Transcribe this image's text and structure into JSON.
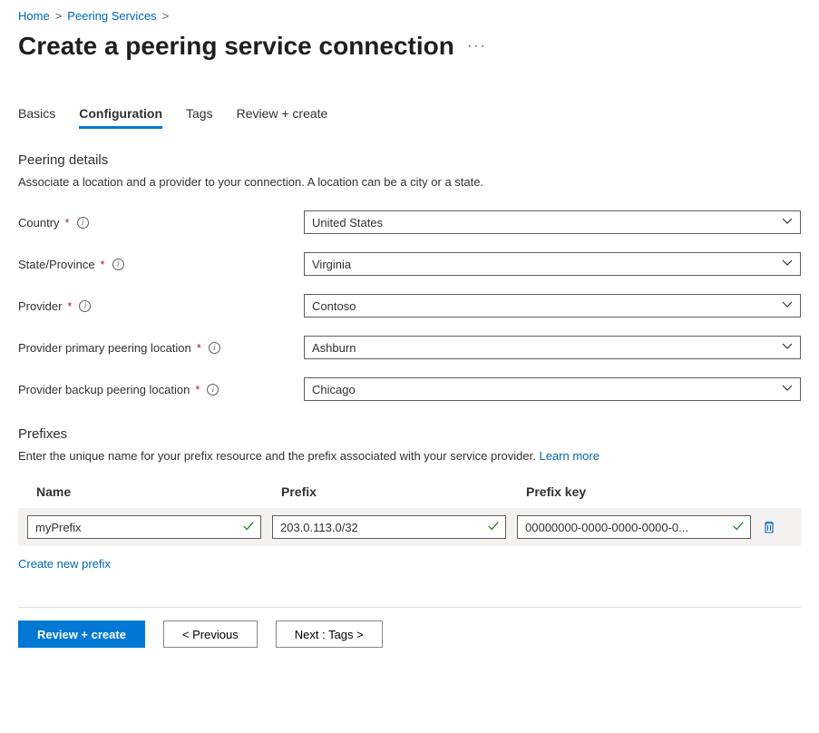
{
  "breadcrumb": {
    "home": "Home",
    "peering_services": "Peering Services"
  },
  "page_title": "Create a peering service connection",
  "tabs": {
    "basics": "Basics",
    "configuration": "Configuration",
    "tags": "Tags",
    "review": "Review + create"
  },
  "peering_details": {
    "heading": "Peering details",
    "description": "Associate a location and a provider to your connection. A location can be a city or a state.",
    "fields": {
      "country": {
        "label": "Country",
        "value": "United States"
      },
      "state": {
        "label": "State/Province",
        "value": "Virginia"
      },
      "provider": {
        "label": "Provider",
        "value": "Contoso"
      },
      "primary_location": {
        "label": "Provider primary peering location",
        "value": "Ashburn"
      },
      "backup_location": {
        "label": "Provider backup peering location",
        "value": "Chicago"
      }
    }
  },
  "prefixes": {
    "heading": "Prefixes",
    "description_pre": "Enter the unique name for your prefix resource and the prefix associated with your service provider. ",
    "learn_more": "Learn more",
    "columns": {
      "name": "Name",
      "prefix": "Prefix",
      "key": "Prefix key"
    },
    "rows": [
      {
        "name": "myPrefix",
        "prefix": "203.0.113.0/32",
        "key": "00000000-0000-0000-0000-0..."
      }
    ],
    "create_new": "Create new prefix"
  },
  "footer": {
    "review_create": "Review + create",
    "previous": "< Previous",
    "next": "Next : Tags >"
  }
}
